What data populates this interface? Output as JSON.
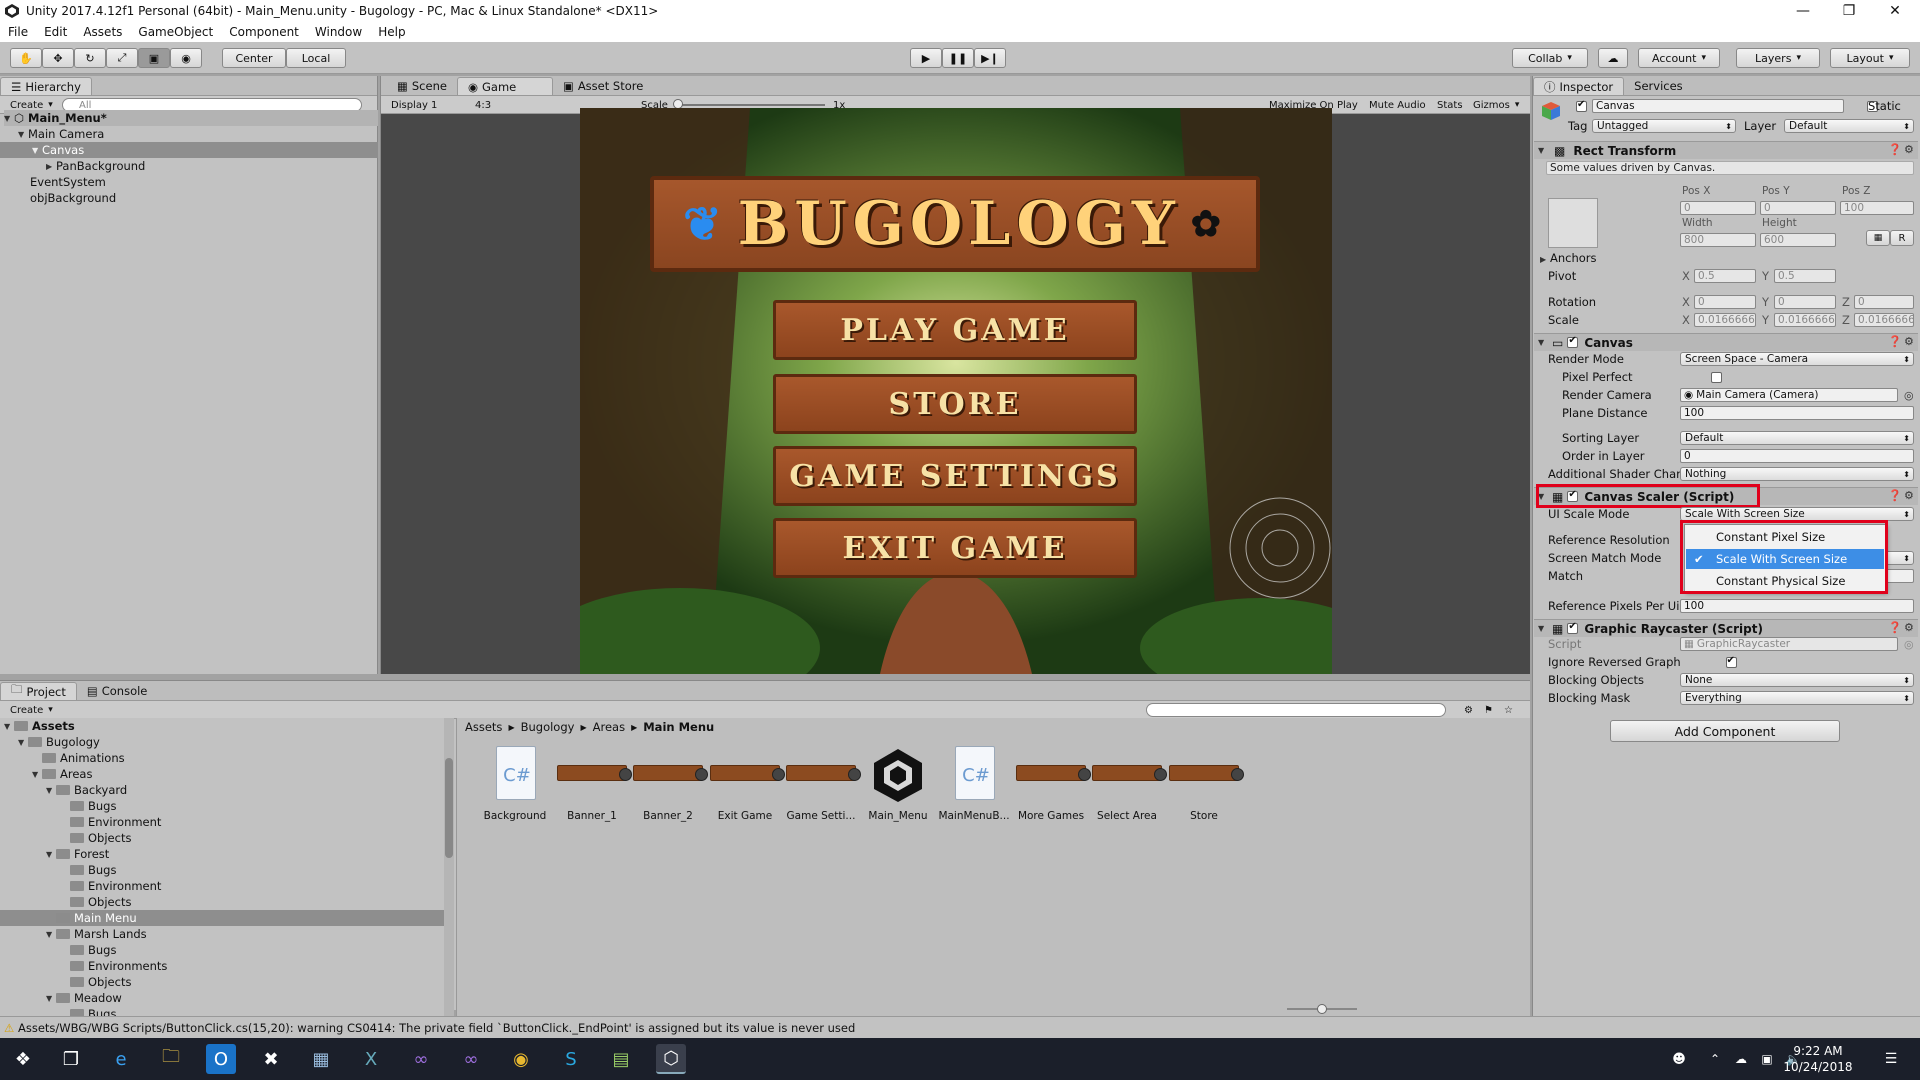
{
  "window": {
    "title": "Unity 2017.4.12f1 Personal (64bit) - Main_Menu.unity - Bugology - PC, Mac & Linux Standalone* <DX11>"
  },
  "menu": [
    "File",
    "Edit",
    "Assets",
    "GameObject",
    "Component",
    "Window",
    "Help"
  ],
  "toolbar": {
    "center": "Center",
    "local": "Local",
    "collab": "Collab",
    "account": "Account",
    "layers": "Layers",
    "layout": "Layout"
  },
  "hierarchy": {
    "tab": "Hierarchy",
    "create": "Create",
    "search_placeholder": "All",
    "scene": "Main_Menu*",
    "items": [
      "Main Camera",
      "Canvas",
      "PanBackground",
      "EventSystem",
      "objBackground"
    ]
  },
  "gameview": {
    "tabs": [
      "Scene",
      "Game",
      "Asset Store"
    ],
    "display": "Display 1",
    "aspect": "4:3",
    "scale_label": "Scale",
    "scale_value": "1x",
    "options": [
      "Maximize On Play",
      "Mute Audio",
      "Stats",
      "Gizmos"
    ],
    "logo": "BUGOLOGY",
    "buttons": [
      "PLAY GAME",
      "STORE",
      "GAME SETTINGS",
      "EXIT GAME"
    ]
  },
  "project": {
    "tabs": [
      "Project",
      "Console"
    ],
    "create": "Create",
    "breadcrumb": [
      "Assets",
      "Bugology",
      "Areas",
      "Main Menu"
    ],
    "tree": [
      {
        "label": "Assets",
        "depth": 0,
        "bold": true
      },
      {
        "label": "Bugology",
        "depth": 1
      },
      {
        "label": "Animations",
        "depth": 2
      },
      {
        "label": "Areas",
        "depth": 2
      },
      {
        "label": "Backyard",
        "depth": 3
      },
      {
        "label": "Bugs",
        "depth": 4
      },
      {
        "label": "Environment",
        "depth": 4
      },
      {
        "label": "Objects",
        "depth": 4
      },
      {
        "label": "Forest",
        "depth": 3
      },
      {
        "label": "Bugs",
        "depth": 4
      },
      {
        "label": "Environment",
        "depth": 4
      },
      {
        "label": "Objects",
        "depth": 4
      },
      {
        "label": "Main Menu",
        "depth": 3,
        "selected": true
      },
      {
        "label": "Marsh Lands",
        "depth": 3
      },
      {
        "label": "Bugs",
        "depth": 4
      },
      {
        "label": "Environments",
        "depth": 4
      },
      {
        "label": "Objects",
        "depth": 4
      },
      {
        "label": "Meadow",
        "depth": 3
      },
      {
        "label": "Bugs",
        "depth": 4
      }
    ],
    "assets": [
      {
        "label": "Background",
        "kind": "cs"
      },
      {
        "label": "Banner_1",
        "kind": "banner"
      },
      {
        "label": "Banner_2",
        "kind": "banner"
      },
      {
        "label": "Exit Game",
        "kind": "banner"
      },
      {
        "label": "Game Setti...",
        "kind": "banner"
      },
      {
        "label": "Main_Menu",
        "kind": "unity"
      },
      {
        "label": "MainMenuB...",
        "kind": "cs"
      },
      {
        "label": "More Games",
        "kind": "banner"
      },
      {
        "label": "Select Area",
        "kind": "banner"
      },
      {
        "label": "Store",
        "kind": "banner"
      }
    ]
  },
  "inspector": {
    "tabs": [
      "Inspector",
      "Services"
    ],
    "object_name": "Canvas",
    "static": "Static",
    "tag_label": "Tag",
    "tag": "Untagged",
    "layer_label": "Layer",
    "layer": "Default",
    "rect": {
      "title": "Rect Transform",
      "note": "Some values driven by Canvas.",
      "posx_l": "Pos X",
      "posy_l": "Pos Y",
      "posz_l": "Pos Z",
      "posx": "0",
      "posy": "0",
      "posz": "100",
      "width_l": "Width",
      "height_l": "Height",
      "width": "800",
      "height": "600",
      "anchors": "Anchors",
      "pivot": "Pivot",
      "pivot_x": "0.5",
      "pivot_y": "0.5",
      "rotation": "Rotation",
      "rot_x": "0",
      "rot_y": "0",
      "rot_z": "0",
      "scale": "Scale",
      "scale_x": "0.0166666",
      "scale_y": "0.0166666",
      "scale_z": "0.0166666",
      "r_btn": "R"
    },
    "canvas": {
      "title": "Canvas",
      "render_mode_l": "Render Mode",
      "render_mode": "Screen Space - Camera",
      "pixel_perfect_l": "Pixel Perfect",
      "render_camera_l": "Render Camera",
      "render_camera": "Main Camera (Camera)",
      "plane_distance_l": "Plane Distance",
      "plane_distance": "100",
      "sorting_layer_l": "Sorting Layer",
      "sorting_layer": "Default",
      "order_l": "Order in Layer",
      "order": "0",
      "shader_l": "Additional Shader Char",
      "shader": "Nothing"
    },
    "scaler": {
      "title": "Canvas Scaler (Script)",
      "ui_scale_mode_l": "UI Scale Mode",
      "ui_scale_mode": "Scale With Screen Size",
      "ref_res_l": "Reference Resolution",
      "match_mode_l": "Screen Match Mode",
      "match_l": "Match",
      "ref_ppu_l": "Reference Pixels Per Ui",
      "ref_ppu": "100",
      "options": [
        "Constant Pixel Size",
        "Scale With Screen Size",
        "Constant Physical Size"
      ],
      "selected_option": "Scale With Screen Size"
    },
    "raycaster": {
      "title": "Graphic Raycaster (Script)",
      "script_l": "Script",
      "script": "GraphicRaycaster",
      "ignore_l": "Ignore Reversed Graph",
      "blocking_l": "Blocking Objects",
      "blocking": "None",
      "mask_l": "Blocking Mask",
      "mask": "Everything"
    },
    "add_component": "Add Component"
  },
  "status": "Assets/WBG/WBG Scripts/ButtonClick.cs(15,20): warning CS0414: The private field `ButtonClick._EndPoint' is assigned but its value is never used",
  "taskbar": {
    "time": "9:22 AM",
    "date": "10/24/2018"
  },
  "colors": {
    "selection_blue": "#3d8ee6",
    "highlight_red": "#e0001b",
    "row_selected": "#8e8e8e"
  }
}
